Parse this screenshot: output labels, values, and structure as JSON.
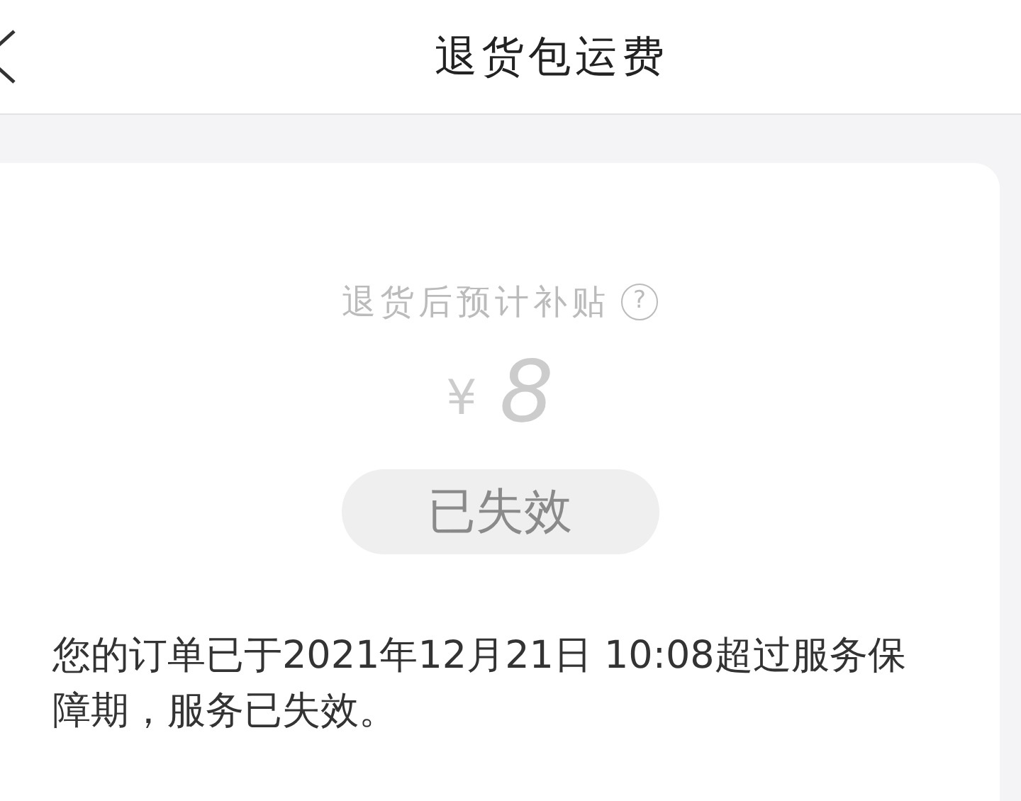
{
  "header": {
    "title": "退货包运费"
  },
  "card": {
    "subsidy_label": "退货后预计补贴",
    "help_mark": "?",
    "currency": "¥",
    "amount": "8",
    "status_button": {
      "label": "已失效",
      "disabled": true
    },
    "notice": "您的订单已于2021年12月21日 10:08超过服务保障期，服务已失效。"
  }
}
